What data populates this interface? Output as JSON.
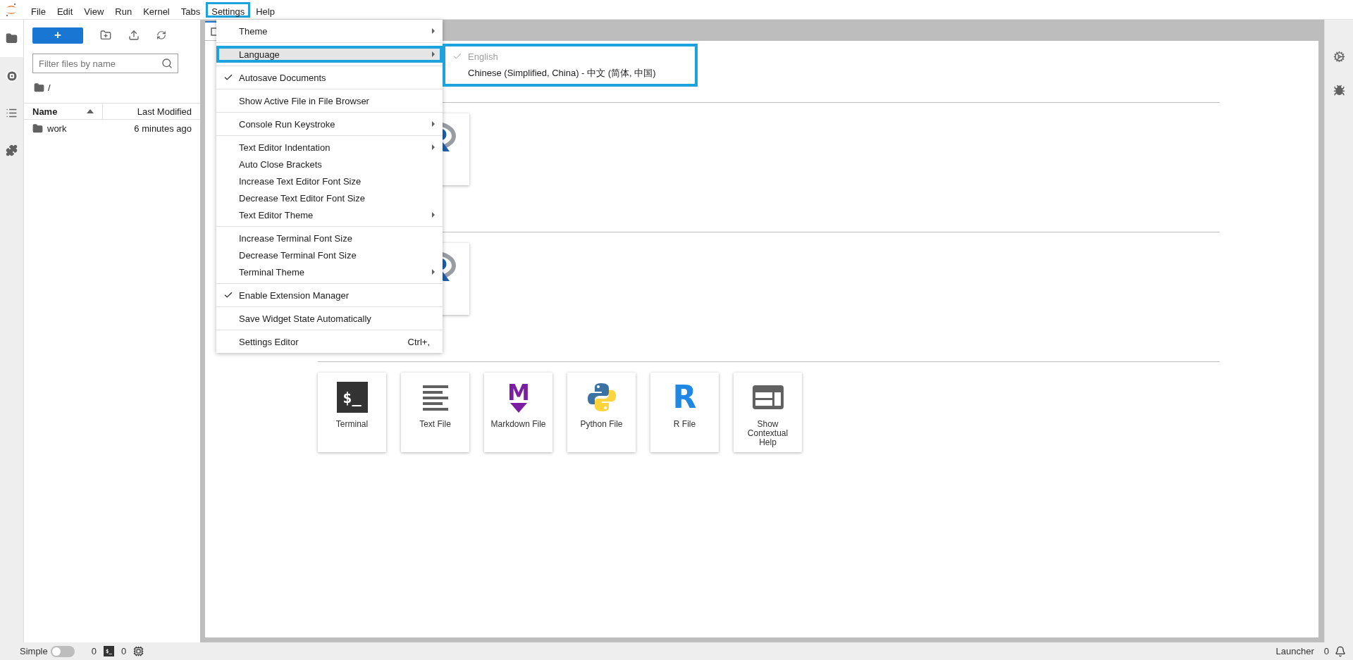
{
  "menubar": {
    "items": [
      {
        "label": "File",
        "selected": false
      },
      {
        "label": "Edit",
        "selected": false
      },
      {
        "label": "View",
        "selected": false
      },
      {
        "label": "Run",
        "selected": false
      },
      {
        "label": "Kernel",
        "selected": false
      },
      {
        "label": "Tabs",
        "selected": false
      },
      {
        "label": "Settings",
        "selected": true
      },
      {
        "label": "Help",
        "selected": false
      }
    ]
  },
  "left_tabs": [
    {
      "kind": "files",
      "selected": true
    },
    {
      "kind": "running",
      "selected": false
    },
    {
      "kind": "toc",
      "selected": false
    },
    {
      "kind": "extensions",
      "selected": false
    }
  ],
  "file_browser": {
    "new_button": "+",
    "filter": {
      "placeholder": "Filter files by name"
    },
    "path": "/",
    "columns": [
      {
        "label": "Name",
        "sorted": true
      },
      {
        "label": "Last Modified",
        "sorted": false
      }
    ],
    "rows": [
      {
        "kind": "folder",
        "name": "work",
        "modified": "6 minutes ago"
      }
    ]
  },
  "launcher": {
    "sections": [
      {
        "cards": [
          {
            "kind": "r-kernel"
          }
        ]
      },
      {
        "cards": [
          {
            "kind": "r-kernel"
          }
        ]
      },
      {
        "cards": [
          {
            "kind": "terminal",
            "glyph": "$_",
            "label": "Terminal"
          },
          {
            "kind": "text",
            "label": "Text File"
          },
          {
            "kind": "markdown",
            "glyph": "M",
            "label": "Markdown File"
          },
          {
            "kind": "python",
            "label": "Python File"
          },
          {
            "kind": "r",
            "glyph": "R",
            "label": "R File"
          },
          {
            "kind": "help",
            "label": "Show Contextual Help"
          }
        ]
      }
    ]
  },
  "settings_menu": {
    "groups": [
      {
        "items": [
          {
            "label": "Theme",
            "submenu": true,
            "checked": false,
            "selected": false
          }
        ]
      },
      {
        "items": [
          {
            "label": "Language",
            "submenu": true,
            "checked": false,
            "selected": true
          }
        ]
      },
      {
        "items": [
          {
            "label": "Autosave Documents",
            "submenu": false,
            "checked": true,
            "selected": false
          }
        ]
      },
      {
        "items": [
          {
            "label": "Show Active File in File Browser",
            "submenu": false,
            "checked": false,
            "selected": false
          }
        ]
      },
      {
        "items": [
          {
            "label": "Console Run Keystroke",
            "submenu": true,
            "checked": false,
            "selected": false
          }
        ]
      },
      {
        "items": [
          {
            "label": "Text Editor Indentation",
            "submenu": true,
            "checked": false,
            "selected": false
          },
          {
            "label": "Auto Close Brackets",
            "submenu": false,
            "checked": false,
            "selected": false
          },
          {
            "label": "Increase Text Editor Font Size",
            "submenu": false,
            "checked": false,
            "selected": false
          },
          {
            "label": "Decrease Text Editor Font Size",
            "submenu": false,
            "checked": false,
            "selected": false
          },
          {
            "label": "Text Editor Theme",
            "submenu": true,
            "checked": false,
            "selected": false
          }
        ]
      },
      {
        "items": [
          {
            "label": "Increase Terminal Font Size",
            "submenu": false,
            "checked": false,
            "selected": false
          },
          {
            "label": "Decrease Terminal Font Size",
            "submenu": false,
            "checked": false,
            "selected": false
          },
          {
            "label": "Terminal Theme",
            "submenu": true,
            "checked": false,
            "selected": false
          }
        ]
      },
      {
        "items": [
          {
            "label": "Enable Extension Manager",
            "submenu": false,
            "checked": true,
            "selected": false
          }
        ]
      },
      {
        "items": [
          {
            "label": "Save Widget State Automatically",
            "submenu": false,
            "checked": false,
            "selected": false
          }
        ]
      },
      {
        "items": [
          {
            "label": "Settings Editor",
            "shortcut": "Ctrl+,",
            "submenu": false,
            "checked": false,
            "selected": false
          }
        ]
      }
    ]
  },
  "language_submenu": {
    "items": [
      {
        "label": "English",
        "checked": true,
        "disabled": true
      },
      {
        "label": "Chinese (Simplified, China) - 中文 (简体, 中国)",
        "checked": false,
        "disabled": false
      }
    ]
  },
  "status_bar": {
    "mode_label": "Simple",
    "simple_mode": false,
    "kernels": "0",
    "terminals_glyph": "$_",
    "terminals": "0",
    "right_label": "Launcher",
    "notifications": "0"
  }
}
